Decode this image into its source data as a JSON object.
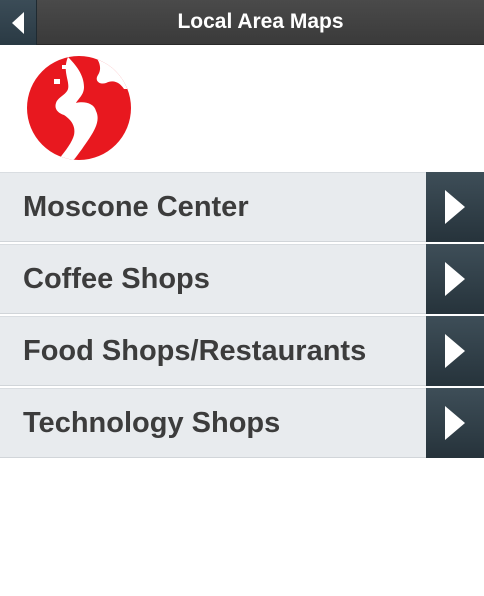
{
  "header": {
    "title": "Local Area Maps",
    "back_icon": "back-arrow-icon"
  },
  "logo": {
    "icon": "globe-americas-icon",
    "color": "#e8181f"
  },
  "menu": {
    "items": [
      {
        "label": "Moscone Center",
        "icon": "chevron-right-icon"
      },
      {
        "label": "Coffee Shops",
        "icon": "chevron-right-icon"
      },
      {
        "label": "Food Shops/Restaurants",
        "icon": "chevron-right-icon"
      },
      {
        "label": "Technology Shops",
        "icon": "chevron-right-icon"
      }
    ]
  },
  "colors": {
    "header_bg": "#404040",
    "row_bg": "#e8ebee",
    "arrow_bg": "#2f3d46",
    "text": "#3c3c3c"
  }
}
